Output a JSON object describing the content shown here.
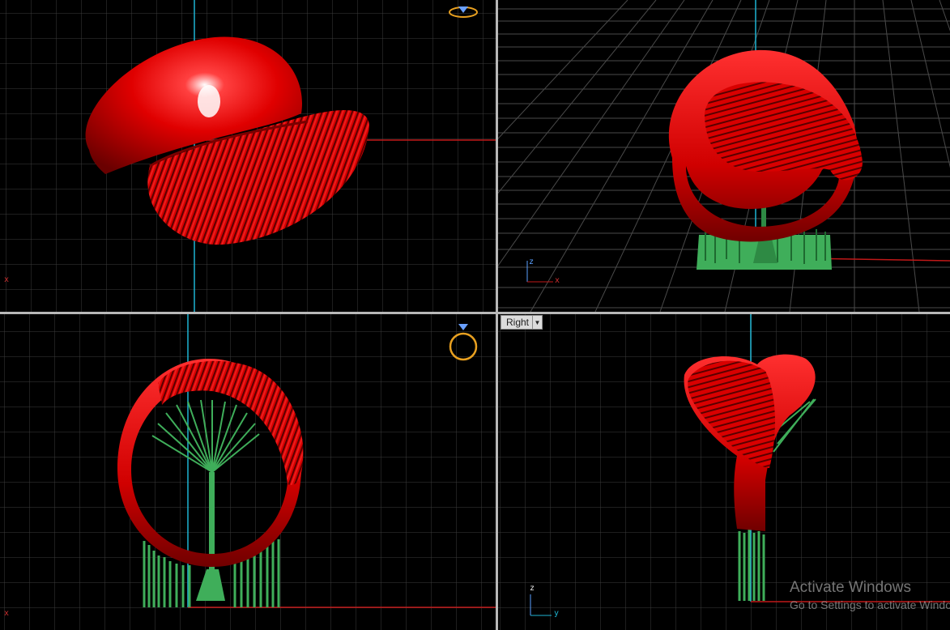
{
  "viewports": {
    "right": {
      "label": "Right"
    }
  },
  "axes": {
    "top_x": "x",
    "persp_z": "z",
    "persp_x": "x",
    "front_x": "x",
    "right_z": "z",
    "right_y": "y"
  },
  "watermark": {
    "title": "Activate Windows",
    "subtitle": "Go to Settings to activate Windows."
  },
  "icons": {
    "viewcube_top": "ring-viewcube-icon",
    "viewcube_front": "ring-viewcube-icon",
    "dropdown": "chevron-down-icon"
  },
  "colors": {
    "background": "#000000",
    "grid": "#3c3c3c",
    "axis_red": "#c01818",
    "axis_blue": "#1eb4d2",
    "model_red": "#e00000",
    "support_green": "#3fae5a"
  }
}
